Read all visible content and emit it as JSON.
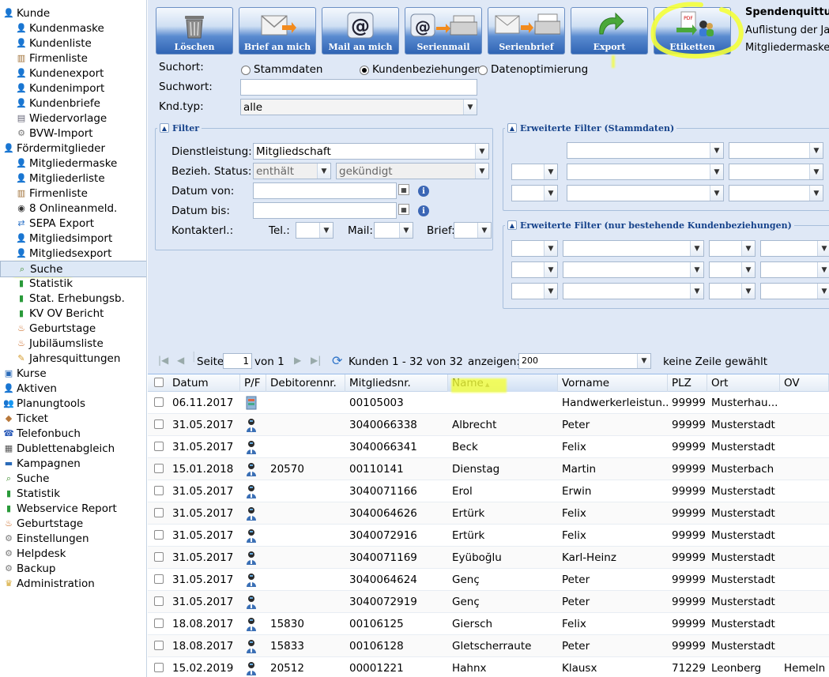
{
  "sidebar": {
    "items": [
      {
        "label": "Kunde",
        "level": 0,
        "icon": "person-icon"
      },
      {
        "label": "Kundenmaske",
        "level": 1,
        "icon": "person-icon"
      },
      {
        "label": "Kundenliste",
        "level": 1,
        "icon": "person-list-icon"
      },
      {
        "label": "Firmenliste",
        "level": 1,
        "icon": "building-icon"
      },
      {
        "label": "Kundenexport",
        "level": 1,
        "icon": "person-icon"
      },
      {
        "label": "Kundenimport",
        "level": 1,
        "icon": "person-icon"
      },
      {
        "label": "Kundenbriefe",
        "level": 1,
        "icon": "person-icon"
      },
      {
        "label": "Wiedervorlage",
        "level": 1,
        "icon": "document-icon"
      },
      {
        "label": "BVW-Import",
        "level": 1,
        "icon": "gear-icon"
      },
      {
        "label": "Fördermitglieder",
        "level": 0,
        "icon": "person-icon"
      },
      {
        "label": "Mitgliedermaske",
        "level": 1,
        "icon": "person-icon"
      },
      {
        "label": "Mitgliederliste",
        "level": 1,
        "icon": "person-list-icon"
      },
      {
        "label": "Firmenliste",
        "level": 1,
        "icon": "building-icon"
      },
      {
        "label": "8  Onlineanmeld.",
        "level": 1,
        "icon": "eye-icon"
      },
      {
        "label": "SEPA Export",
        "level": 1,
        "icon": "export-icon"
      },
      {
        "label": "Mitgliedsimport",
        "level": 1,
        "icon": "person-icon"
      },
      {
        "label": "Mitgliedsexport",
        "level": 1,
        "icon": "person-icon"
      },
      {
        "label": "Suche",
        "level": 1,
        "icon": "search-icon",
        "selected": true
      },
      {
        "label": "Statistik",
        "level": 1,
        "icon": "bar-chart-icon"
      },
      {
        "label": "Stat. Erhebungsb.",
        "level": 1,
        "icon": "bar-chart-icon"
      },
      {
        "label": "KV OV Bericht",
        "level": 1,
        "icon": "bar-chart-icon"
      },
      {
        "label": "Geburtstage",
        "level": 1,
        "icon": "cake-icon"
      },
      {
        "label": "Jubiläumsliste",
        "level": 1,
        "icon": "cake-icon"
      },
      {
        "label": "Jahresquittungen",
        "level": 1,
        "icon": "receipt-icon"
      },
      {
        "label": "Kurse",
        "level": 0,
        "icon": "book-icon"
      },
      {
        "label": "Aktiven",
        "level": 0,
        "icon": "person-icon"
      },
      {
        "label": "Planungtools",
        "level": 0,
        "icon": "people-icon"
      },
      {
        "label": "Ticket",
        "level": 0,
        "icon": "ticket-icon"
      },
      {
        "label": "Telefonbuch",
        "level": 0,
        "icon": "phone-icon"
      },
      {
        "label": "Dublettenabgleich",
        "level": 0,
        "icon": "compare-icon"
      },
      {
        "label": "Kampagnen",
        "level": 0,
        "icon": "folder-icon"
      },
      {
        "label": "Suche",
        "level": 0,
        "icon": "search-icon"
      },
      {
        "label": "Statistik",
        "level": 0,
        "icon": "bar-chart-icon"
      },
      {
        "label": "Webservice Report",
        "level": 0,
        "icon": "bar-chart-icon"
      },
      {
        "label": "Geburtstage",
        "level": 0,
        "icon": "cake-icon"
      },
      {
        "label": "Einstellungen",
        "level": 0,
        "icon": "gear-icon"
      },
      {
        "label": "Helpdesk",
        "level": 0,
        "icon": "gear-icon"
      },
      {
        "label": "Backup",
        "level": 0,
        "icon": "gear-icon"
      },
      {
        "label": "Administration",
        "level": 0,
        "icon": "admin-icon"
      }
    ]
  },
  "toolbar": {
    "buttons": [
      {
        "label": "Löschen",
        "icon": "trash-icon"
      },
      {
        "label": "Brief an mich",
        "icon": "letter-icon"
      },
      {
        "label": "Mail an mich",
        "icon": "at-icon"
      },
      {
        "label": "Serienmail",
        "icon": "serienmail-icon"
      },
      {
        "label": "Serienbrief",
        "icon": "printer-icon"
      },
      {
        "label": "Export",
        "icon": "export-arrow-icon"
      },
      {
        "label": "Etiketten",
        "icon": "labels-icon"
      }
    ]
  },
  "info": {
    "title": "Spendenquittu",
    "line1": "Auflistung der Ja",
    "line2": "Mitgliedermaske"
  },
  "search": {
    "suchort_label": "Suchort:",
    "options": [
      "Stammdaten",
      "Kundenbeziehungen",
      "Datenoptimierung"
    ],
    "selected_option": "Kundenbeziehungen",
    "suchwort_label": "Suchwort:",
    "suchwort_value": "",
    "kndtyp_label": "Knd.typ:",
    "kndtyp_value": "alle"
  },
  "filter": {
    "legend": "Filter",
    "dienstleistung_label": "Dienstleistung:",
    "dienstleistung_value": "Mitgliedschaft",
    "status_label": "Bezieh. Status:",
    "status_op": "enthält",
    "status_value": "gekündigt",
    "datum_von_label": "Datum von:",
    "datum_bis_label": "Datum bis:",
    "kontakt_label": "Kontakterl.:",
    "tel_label": "Tel.:",
    "mail_label": "Mail:",
    "brief_label": "Brief:"
  },
  "ext_filter": {
    "legend": "Erweiterte Filter (Stammdaten)"
  },
  "ext_filter2": {
    "legend": "Erweiterte Filter (nur bestehende Kundenbeziehungen)"
  },
  "pager": {
    "page_label": "Seite",
    "page_value": "1",
    "of_label": "von 1",
    "range_label": "Kunden 1 - 32 von 32",
    "show_label": "anzeigen:",
    "show_value": "200",
    "selection_label": "keine Zeile gewählt"
  },
  "grid": {
    "columns": [
      "Datum",
      "P/F",
      "Debitorennr.",
      "Mitgliedsnr.",
      "Name",
      "Vorname",
      "PLZ",
      "Ort",
      "OV"
    ],
    "sort_column": "Name",
    "rows": [
      {
        "datum": "06.11.2017",
        "pf": "group",
        "debitor": "",
        "mitglied": "00105003",
        "name": "",
        "vorname": "Handwerkerleistun...",
        "plz": "99999",
        "ort": "Musterhau...",
        "ov": ""
      },
      {
        "datum": "31.05.2017",
        "pf": "person",
        "debitor": "",
        "mitglied": "3040066338",
        "name": "Albrecht",
        "vorname": "Peter",
        "plz": "99999",
        "ort": "Musterstadt",
        "ov": ""
      },
      {
        "datum": "31.05.2017",
        "pf": "person",
        "debitor": "",
        "mitglied": "3040066341",
        "name": "Beck",
        "vorname": "Felix",
        "plz": "99999",
        "ort": "Musterstadt",
        "ov": ""
      },
      {
        "datum": "15.01.2018",
        "pf": "person",
        "debitor": "20570",
        "mitglied": "00110141",
        "name": "Dienstag",
        "vorname": "Martin",
        "plz": "99999",
        "ort": "Musterbach",
        "ov": ""
      },
      {
        "datum": "31.05.2017",
        "pf": "person",
        "debitor": "",
        "mitglied": "3040071166",
        "name": "Erol",
        "vorname": "Erwin",
        "plz": "99999",
        "ort": "Musterstadt",
        "ov": ""
      },
      {
        "datum": "31.05.2017",
        "pf": "person",
        "debitor": "",
        "mitglied": "3040064626",
        "name": "Ertürk",
        "vorname": "Felix",
        "plz": "99999",
        "ort": "Musterstadt",
        "ov": ""
      },
      {
        "datum": "31.05.2017",
        "pf": "person",
        "debitor": "",
        "mitglied": "3040072916",
        "name": "Ertürk",
        "vorname": "Felix",
        "plz": "99999",
        "ort": "Musterstadt",
        "ov": ""
      },
      {
        "datum": "31.05.2017",
        "pf": "person",
        "debitor": "",
        "mitglied": "3040071169",
        "name": "Eyüboğlu",
        "vorname": "Karl-Heinz",
        "plz": "99999",
        "ort": "Musterstadt",
        "ov": ""
      },
      {
        "datum": "31.05.2017",
        "pf": "person",
        "debitor": "",
        "mitglied": "3040064624",
        "name": "Genç",
        "vorname": "Peter",
        "plz": "99999",
        "ort": "Musterstadt",
        "ov": ""
      },
      {
        "datum": "31.05.2017",
        "pf": "person",
        "debitor": "",
        "mitglied": "3040072919",
        "name": "Genç",
        "vorname": "Peter",
        "plz": "99999",
        "ort": "Musterstadt",
        "ov": ""
      },
      {
        "datum": "18.08.2017",
        "pf": "person",
        "debitor": "15830",
        "mitglied": "00106125",
        "name": "Giersch",
        "vorname": "Felix",
        "plz": "99999",
        "ort": "Musterstadt",
        "ov": ""
      },
      {
        "datum": "18.08.2017",
        "pf": "person",
        "debitor": "15833",
        "mitglied": "00106128",
        "name": "Gletscherraute",
        "vorname": "Peter",
        "plz": "99999",
        "ort": "Musterstadt",
        "ov": ""
      },
      {
        "datum": "15.02.2019",
        "pf": "person",
        "debitor": "20512",
        "mitglied": "00001221",
        "name": "Hahnx",
        "vorname": "Klausx",
        "plz": "71229",
        "ort": "Leonberg",
        "ov": "Hemeln"
      }
    ]
  },
  "colors": {
    "highlight": "#f4ff3a",
    "toolbar_blue": "#2f64b4",
    "legend_blue": "#15428b",
    "panel_bg": "#dfe8f6"
  }
}
